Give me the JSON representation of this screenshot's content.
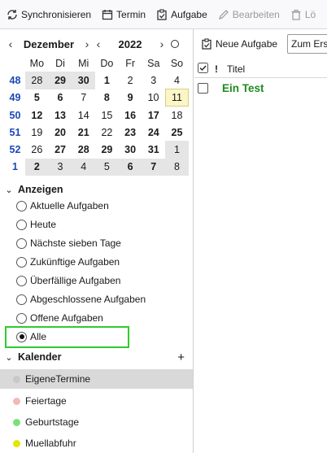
{
  "toolbar": {
    "sync_label": "Synchronisieren",
    "event_label": "Termin",
    "task_label": "Aufgabe",
    "edit_label": "Bearbeiten",
    "delete_label": "Lö"
  },
  "minicalendar": {
    "month": "Dezember",
    "year": "2022",
    "weekday_headers": [
      "Mo",
      "Di",
      "Mi",
      "Do",
      "Fr",
      "Sa",
      "So"
    ],
    "weeks": [
      {
        "week": "48",
        "days": [
          {
            "d": "28",
            "other": true
          },
          {
            "d": "29",
            "bold": true,
            "other": true
          },
          {
            "d": "30",
            "bold": true,
            "other": true
          },
          {
            "d": "1",
            "bold": true
          },
          {
            "d": "2"
          },
          {
            "d": "3"
          },
          {
            "d": "4"
          }
        ]
      },
      {
        "week": "49",
        "days": [
          {
            "d": "5",
            "bold": true
          },
          {
            "d": "6",
            "bold": true
          },
          {
            "d": "7"
          },
          {
            "d": "8",
            "bold": true
          },
          {
            "d": "9",
            "bold": true
          },
          {
            "d": "10"
          },
          {
            "d": "11",
            "today": true
          }
        ]
      },
      {
        "week": "50",
        "days": [
          {
            "d": "12",
            "bold": true
          },
          {
            "d": "13",
            "bold": true
          },
          {
            "d": "14"
          },
          {
            "d": "15"
          },
          {
            "d": "16",
            "bold": true
          },
          {
            "d": "17",
            "bold": true
          },
          {
            "d": "18"
          }
        ]
      },
      {
        "week": "51",
        "days": [
          {
            "d": "19"
          },
          {
            "d": "20",
            "bold": true
          },
          {
            "d": "21",
            "bold": true
          },
          {
            "d": "22"
          },
          {
            "d": "23",
            "bold": true
          },
          {
            "d": "24",
            "bold": true
          },
          {
            "d": "25",
            "bold": true
          }
        ]
      },
      {
        "week": "52",
        "days": [
          {
            "d": "26"
          },
          {
            "d": "27",
            "bold": true
          },
          {
            "d": "28",
            "bold": true
          },
          {
            "d": "29",
            "bold": true
          },
          {
            "d": "30",
            "bold": true
          },
          {
            "d": "31",
            "bold": true
          },
          {
            "d": "1",
            "other": true
          }
        ]
      },
      {
        "week": "1",
        "days": [
          {
            "d": "2",
            "bold": true,
            "other": true
          },
          {
            "d": "3",
            "other": true
          },
          {
            "d": "4",
            "other": true
          },
          {
            "d": "5",
            "other": true
          },
          {
            "d": "6",
            "bold": true,
            "other": true
          },
          {
            "d": "7",
            "bold": true,
            "other": true
          },
          {
            "d": "8",
            "other": true
          }
        ]
      }
    ]
  },
  "filters": {
    "section_label": "Anzeigen",
    "selected": "Alle",
    "items": [
      "Aktuelle Aufgaben",
      "Heute",
      "Nächste sieben Tage",
      "Zukünftige Aufgaben",
      "Überfällige Aufgaben",
      "Abgeschlossene Aufgaben",
      "Offene Aufgaben",
      "Alle"
    ]
  },
  "calendars": {
    "section_label": "Kalender",
    "add_symbol": "+",
    "items": [
      {
        "name": "EigeneTermine",
        "color": "#c8c8c8",
        "selected": true
      },
      {
        "name": "Feiertage",
        "color": "#f4b7b7"
      },
      {
        "name": "Geburtstage",
        "color": "#7be07b"
      },
      {
        "name": "Muellabfuhr",
        "color": "#e5e500"
      }
    ]
  },
  "taskpane": {
    "new_task_label": "Neue Aufgabe",
    "filter_placeholder": "Zum Erstellen",
    "columns": {
      "priority": "!",
      "title": "Titel"
    },
    "tasks": [
      {
        "title": "Ein Test"
      }
    ]
  }
}
